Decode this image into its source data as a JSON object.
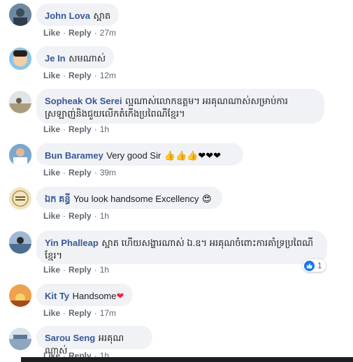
{
  "comments": [
    {
      "author": "John Lova",
      "text": "ស្អាត",
      "actions": {
        "like": "Like",
        "reply": "Reply",
        "time": "27m"
      }
    },
    {
      "author": "Je In",
      "text": "សមណាស់",
      "actions": {
        "like": "Like",
        "reply": "Reply",
        "time": "12m"
      }
    },
    {
      "author": "Sopheak Ok Serei",
      "text": "ល្អណាស់លោកឧត្តម។ អរគុណណាស់សម្រាប់ការស្រឡាញ់និងជួយលើកតំកើងប្រពៃណីខ្មែរ។",
      "actions": {
        "like": "Like",
        "reply": "Reply",
        "time": "1h"
      }
    },
    {
      "author": "Bun Baramey",
      "text": "Very good Sir",
      "emoji": "👍👍👍❤❤❤",
      "actions": {
        "like": "Like",
        "reply": "Reply",
        "time": "39m"
      }
    },
    {
      "author": "ឯក គន្ធី",
      "text": "You look handsome Excellency",
      "emoji": "😍",
      "actions": {
        "like": "Like",
        "reply": "Reply",
        "time": "1h"
      }
    },
    {
      "author": "Yin Phalleap",
      "text": "ស្អាត ហើយសង្ហារណាស់ ឯ.ឧ។ អរគុណចំពោះការគាំទ្រប្រពៃណីខ្មែរ។",
      "actions": {
        "like": "Like",
        "reply": "Reply",
        "time": "1h"
      },
      "reactions": {
        "count": "1"
      }
    },
    {
      "author": "Kit Ty",
      "text": "Handsome",
      "emoji": "❤",
      "actions": {
        "like": "Like",
        "reply": "Reply",
        "time": "17m"
      }
    },
    {
      "author": "Sarou Seng",
      "text": "អរគុណណាស់",
      "actions": {
        "like": "Like",
        "reply": "Reply",
        "time": "1h"
      }
    }
  ],
  "colors": {
    "author": "#385898",
    "bubble": "#f0f2f5",
    "like_badge": "#1877f2",
    "heart": "#f02849",
    "thumb": "#f7b125"
  }
}
